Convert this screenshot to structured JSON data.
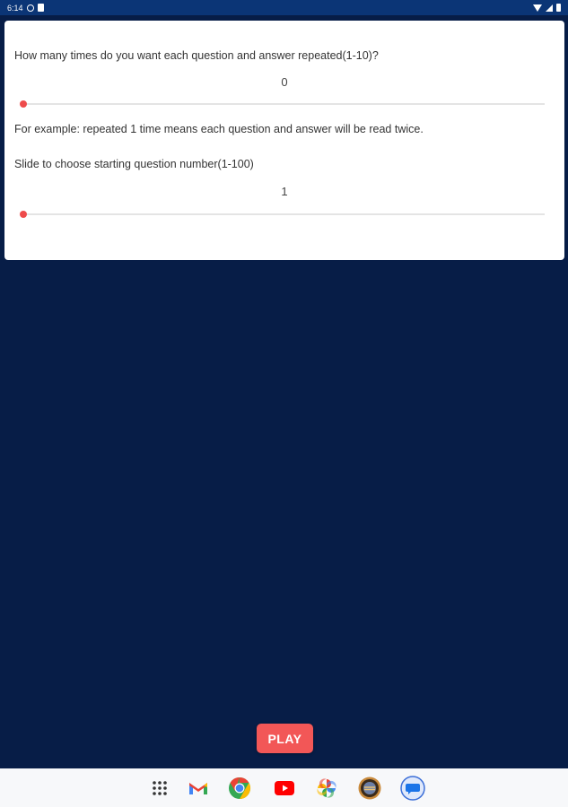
{
  "status_bar": {
    "time": "6:14",
    "icons": [
      "data-saver-icon",
      "sim-card-icon",
      "wifi-icon",
      "signal-icon",
      "battery-icon"
    ]
  },
  "settings_card": {
    "repeat": {
      "label": "How many times do you want each question and answer repeated(1-10)?",
      "value": "0",
      "slider_value": 0,
      "slider_min": 0,
      "slider_max": 10
    },
    "example_text": "For example: repeated 1 time means each question and answer will be read twice.",
    "start": {
      "label": "Slide to choose starting question number(1-100)",
      "value": "1",
      "slider_value": 1,
      "slider_min": 1,
      "slider_max": 100
    }
  },
  "play_button": {
    "label": "PLAY"
  },
  "dock": {
    "apps": [
      "app-drawer-icon",
      "gmail-icon",
      "chrome-icon",
      "youtube-icon",
      "photos-icon",
      "app-badge-icon",
      "messages-icon"
    ]
  },
  "colors": {
    "background": "#071d47",
    "status_bar": "#0b3576",
    "accent": "#ee4b4b",
    "play_button": "#f25757"
  }
}
